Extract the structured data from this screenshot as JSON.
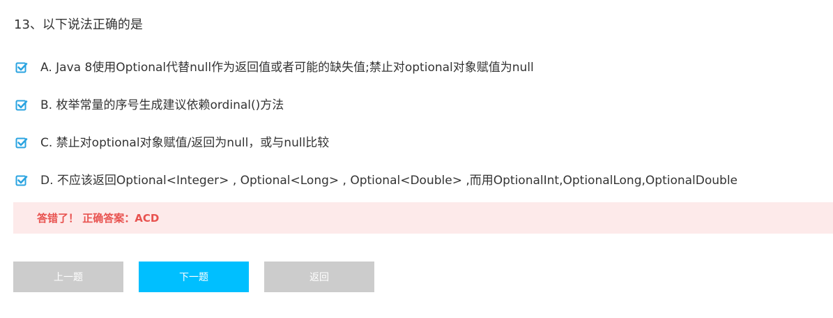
{
  "question": {
    "title": "13、以下说法正确的是"
  },
  "options": [
    {
      "label": "A. Java 8使用Optional代替null作为返回值或者可能的缺失值;禁止对optional对象赋值为null",
      "checked": true
    },
    {
      "label": "B. 枚举常量的序号生成建议依赖ordinal()方法",
      "checked": true
    },
    {
      "label": "C. 禁止对optional对象赋值/返回为null，或与null比较",
      "checked": true
    },
    {
      "label": "D. 不应该返回Optional<Integer> , Optional<Long> , Optional<Double> ,而用OptionalInt,OptionalLong,OptionalDouble",
      "checked": true
    }
  ],
  "result": {
    "text": "答错了！ 正确答案：ACD"
  },
  "buttons": {
    "prev": "上一题",
    "next": "下一题",
    "back": "返回"
  },
  "colors": {
    "checkbox": "#29a3e0",
    "result_bg": "#fdeaea",
    "result_text": "#e8524f",
    "primary_button": "#00bfff",
    "disabled_button": "#cccccc"
  }
}
